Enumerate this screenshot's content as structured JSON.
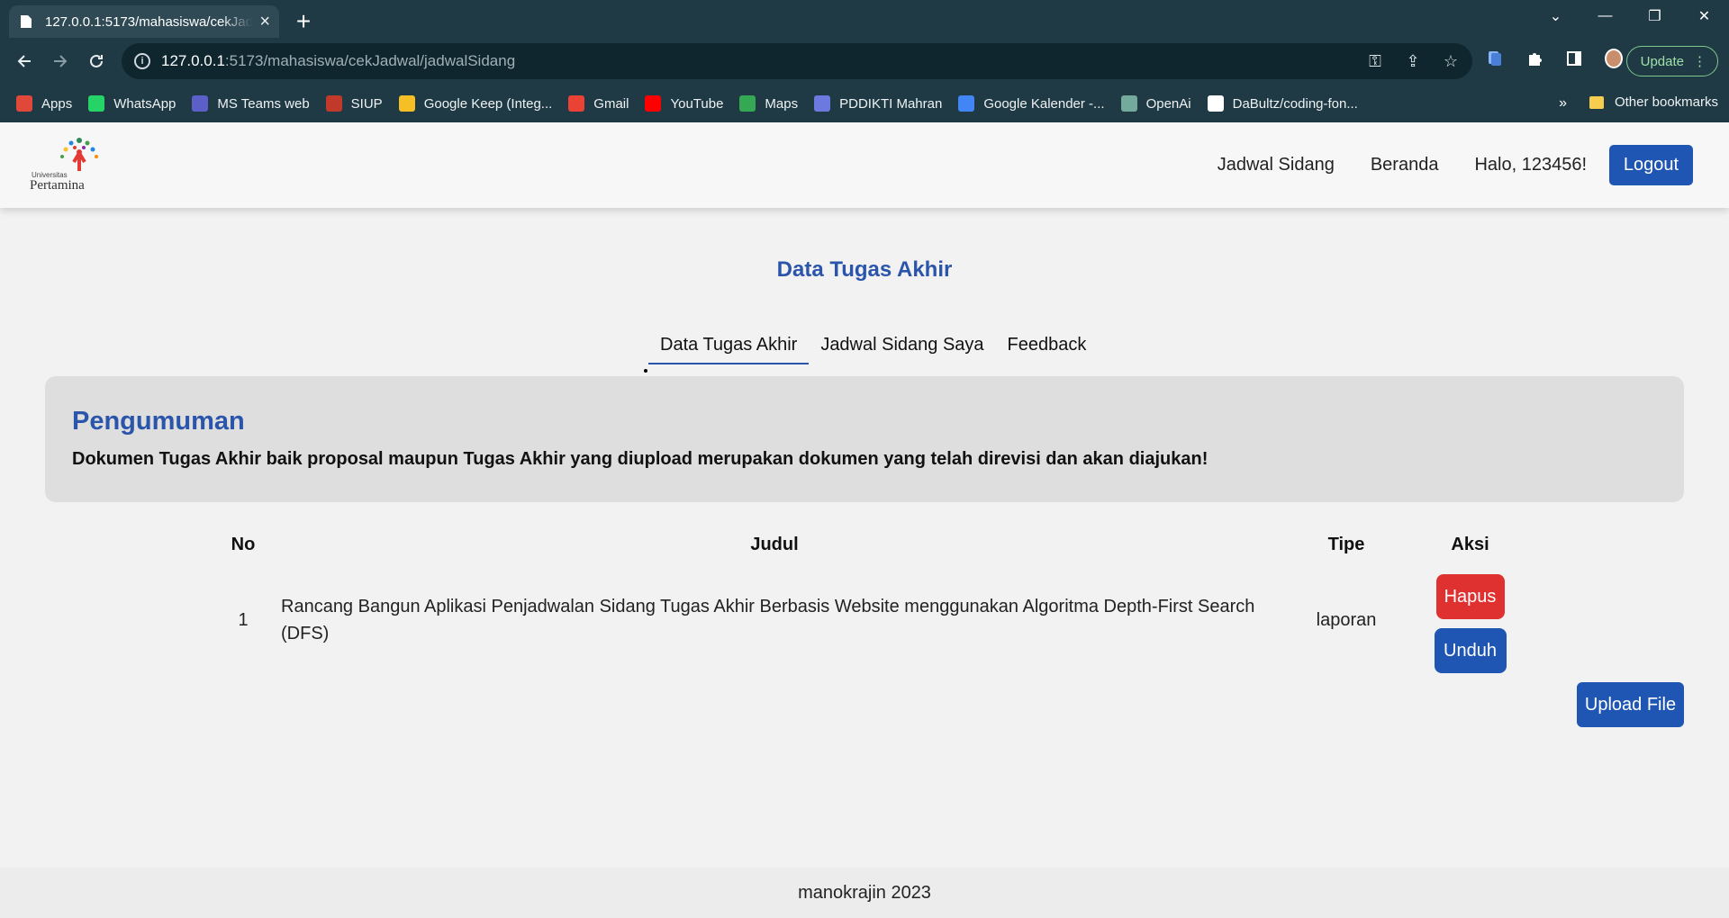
{
  "browser": {
    "tab_title": "127.0.0.1:5173/mahasiswa/cekJadwal/jadwalSidang",
    "url_host": "127.0.0.1",
    "url_rest": ":5173/mahasiswa/cekJadwal/jadwalSidang",
    "update_label": "Update",
    "bookmarks": [
      {
        "label": "Apps",
        "icon": "apps-grid-icon",
        "color": "#e0493a"
      },
      {
        "label": "WhatsApp",
        "icon": "whatsapp-icon",
        "color": "#25d366"
      },
      {
        "label": "MS Teams web",
        "icon": "teams-icon",
        "color": "#5b5fc7"
      },
      {
        "label": "SIUP",
        "icon": "siup-icon",
        "color": "#c0392b"
      },
      {
        "label": "Google Keep (Integ...",
        "icon": "keep-icon",
        "color": "#f6bf26"
      },
      {
        "label": "Gmail",
        "icon": "gmail-icon",
        "color": "#ea4335"
      },
      {
        "label": "YouTube",
        "icon": "youtube-icon",
        "color": "#ff0000"
      },
      {
        "label": "Maps",
        "icon": "maps-icon",
        "color": "#34a853"
      },
      {
        "label": "PDDIKTI Mahran",
        "icon": "pddikti-icon",
        "color": "#6c7ae0"
      },
      {
        "label": "Google Kalender -...",
        "icon": "calendar-icon",
        "color": "#4285f4"
      },
      {
        "label": "OpenAi",
        "icon": "openai-icon",
        "color": "#74aa9c"
      },
      {
        "label": "DaBultz/coding-fon...",
        "icon": "github-icon",
        "color": "#ffffff"
      }
    ],
    "other_bookmarks": "Other bookmarks"
  },
  "navbar": {
    "logo_small": "Universitas",
    "logo_text": "Pertamina",
    "links": [
      "Jadwal Sidang",
      "Beranda"
    ],
    "greeting": "Halo, 123456!",
    "logout_label": "Logout"
  },
  "main": {
    "title": "Data Tugas Akhir",
    "tabs": [
      "Data Tugas Akhir",
      "Jadwal Sidang Saya",
      "Feedback"
    ],
    "announcement": {
      "heading": "Pengumuman",
      "text": "Dokumen Tugas Akhir baik proposal maupun Tugas Akhir yang diupload merupakan dokumen yang telah direvisi dan akan diajukan!"
    },
    "table": {
      "headers": [
        "No",
        "Judul",
        "Tipe",
        "Aksi"
      ],
      "rows": [
        {
          "no": "1",
          "judul": "Rancang Bangun Aplikasi Penjadwalan Sidang Tugas Akhir Berbasis Website menggunakan Algoritma Depth-First Search (DFS)",
          "tipe": "laporan",
          "hapus_label": "Hapus",
          "unduh_label": "Unduh"
        }
      ]
    },
    "upload_label": "Upload File"
  },
  "footer": {
    "text": "manokrajin 2023"
  },
  "colors": {
    "primary": "#1f56b3",
    "danger": "#e03131",
    "heading": "#2a55aa"
  }
}
